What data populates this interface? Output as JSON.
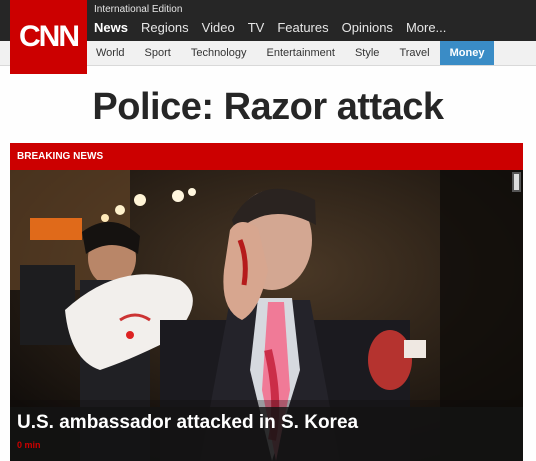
{
  "header": {
    "logo_text": "CNN",
    "edition_label": "International Edition",
    "main_nav": [
      "News",
      "Regions",
      "Video",
      "TV",
      "Features",
      "Opinions",
      "More..."
    ],
    "sub_nav": [
      "World",
      "Sport",
      "Technology",
      "Entertainment",
      "Style",
      "Travel",
      "Money"
    ]
  },
  "headline": "Police: Razor attack",
  "breaking": {
    "label": "BREAKING NEWS",
    "caption_title": "U.S. ambassador attacked in S. Korea",
    "caption_time": "0 min"
  },
  "colors": {
    "brand_red": "#cc0000",
    "topbar": "#262626",
    "active_subnav": "#3a8cc6"
  }
}
